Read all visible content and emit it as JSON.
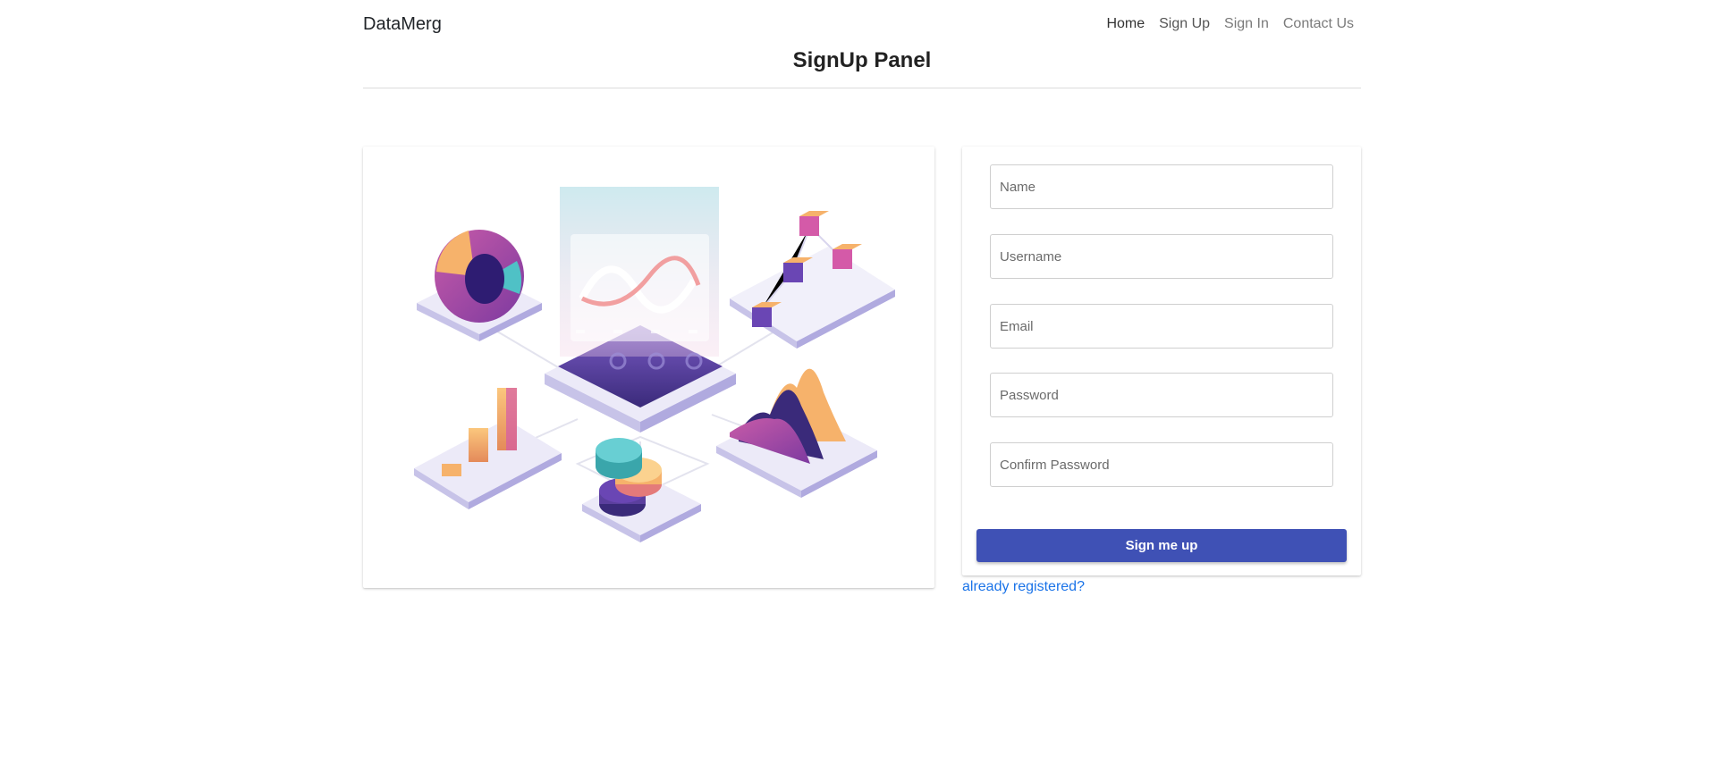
{
  "brand": "DataMerg",
  "nav": {
    "home": "Home",
    "signup": "Sign Up",
    "signin": "Sign In",
    "contact": "Contact Us"
  },
  "page_title": "SignUp Panel",
  "form": {
    "name_placeholder": "Name",
    "username_placeholder": "Username",
    "email_placeholder": "Email",
    "password_placeholder": "Password",
    "confirm_password_placeholder": "Confirm Password",
    "submit_label": "Sign me up"
  },
  "login_link": "already registered?",
  "colors": {
    "primary_button": "#3f51b5",
    "link": "#1a73e8",
    "illustration_purple": "#5b3f9e",
    "illustration_pink": "#d45aa8",
    "illustration_orange": "#f6b26b",
    "illustration_teal": "#4fc1c6"
  },
  "icons": {
    "illustration": "isometric-data-analytics-illustration"
  }
}
